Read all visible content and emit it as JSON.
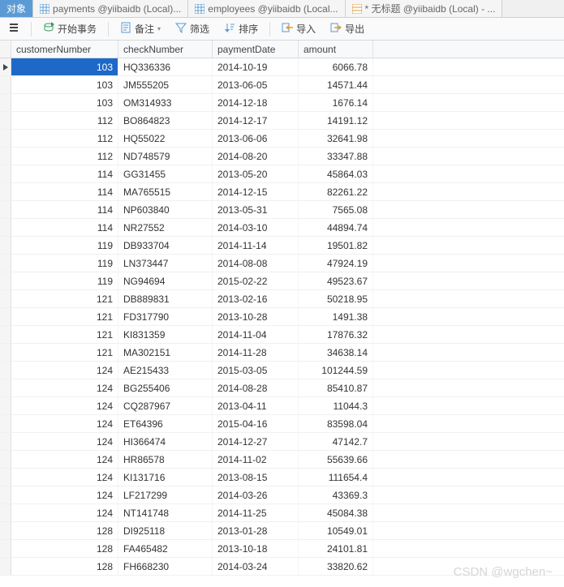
{
  "tabs": [
    {
      "label": "对象"
    },
    {
      "label": "payments @yiibaidb (Local)..."
    },
    {
      "label": "employees @yiibaidb (Local..."
    },
    {
      "label": "* 无标题 @yiibaidb (Local) - ..."
    }
  ],
  "toolbar": {
    "begin_tx": "开始事务",
    "memo": "备注",
    "filter": "筛选",
    "sort": "排序",
    "import": "导入",
    "export": "导出"
  },
  "columns": {
    "customerNumber": "customerNumber",
    "checkNumber": "checkNumber",
    "paymentDate": "paymentDate",
    "amount": "amount"
  },
  "rows": [
    {
      "customerNumber": "103",
      "checkNumber": "HQ336336",
      "paymentDate": "2014-10-19",
      "amount": "6066.78",
      "selected": true
    },
    {
      "customerNumber": "103",
      "checkNumber": "JM555205",
      "paymentDate": "2013-06-05",
      "amount": "14571.44"
    },
    {
      "customerNumber": "103",
      "checkNumber": "OM314933",
      "paymentDate": "2014-12-18",
      "amount": "1676.14"
    },
    {
      "customerNumber": "112",
      "checkNumber": "BO864823",
      "paymentDate": "2014-12-17",
      "amount": "14191.12"
    },
    {
      "customerNumber": "112",
      "checkNumber": "HQ55022",
      "paymentDate": "2013-06-06",
      "amount": "32641.98"
    },
    {
      "customerNumber": "112",
      "checkNumber": "ND748579",
      "paymentDate": "2014-08-20",
      "amount": "33347.88"
    },
    {
      "customerNumber": "114",
      "checkNumber": "GG31455",
      "paymentDate": "2013-05-20",
      "amount": "45864.03"
    },
    {
      "customerNumber": "114",
      "checkNumber": "MA765515",
      "paymentDate": "2014-12-15",
      "amount": "82261.22"
    },
    {
      "customerNumber": "114",
      "checkNumber": "NP603840",
      "paymentDate": "2013-05-31",
      "amount": "7565.08"
    },
    {
      "customerNumber": "114",
      "checkNumber": "NR27552",
      "paymentDate": "2014-03-10",
      "amount": "44894.74"
    },
    {
      "customerNumber": "119",
      "checkNumber": "DB933704",
      "paymentDate": "2014-11-14",
      "amount": "19501.82"
    },
    {
      "customerNumber": "119",
      "checkNumber": "LN373447",
      "paymentDate": "2014-08-08",
      "amount": "47924.19"
    },
    {
      "customerNumber": "119",
      "checkNumber": "NG94694",
      "paymentDate": "2015-02-22",
      "amount": "49523.67"
    },
    {
      "customerNumber": "121",
      "checkNumber": "DB889831",
      "paymentDate": "2013-02-16",
      "amount": "50218.95"
    },
    {
      "customerNumber": "121",
      "checkNumber": "FD317790",
      "paymentDate": "2013-10-28",
      "amount": "1491.38"
    },
    {
      "customerNumber": "121",
      "checkNumber": "KI831359",
      "paymentDate": "2014-11-04",
      "amount": "17876.32"
    },
    {
      "customerNumber": "121",
      "checkNumber": "MA302151",
      "paymentDate": "2014-11-28",
      "amount": "34638.14"
    },
    {
      "customerNumber": "124",
      "checkNumber": "AE215433",
      "paymentDate": "2015-03-05",
      "amount": "101244.59"
    },
    {
      "customerNumber": "124",
      "checkNumber": "BG255406",
      "paymentDate": "2014-08-28",
      "amount": "85410.87"
    },
    {
      "customerNumber": "124",
      "checkNumber": "CQ287967",
      "paymentDate": "2013-04-11",
      "amount": "11044.3"
    },
    {
      "customerNumber": "124",
      "checkNumber": "ET64396",
      "paymentDate": "2015-04-16",
      "amount": "83598.04"
    },
    {
      "customerNumber": "124",
      "checkNumber": "HI366474",
      "paymentDate": "2014-12-27",
      "amount": "47142.7"
    },
    {
      "customerNumber": "124",
      "checkNumber": "HR86578",
      "paymentDate": "2014-11-02",
      "amount": "55639.66"
    },
    {
      "customerNumber": "124",
      "checkNumber": "KI131716",
      "paymentDate": "2013-08-15",
      "amount": "111654.4"
    },
    {
      "customerNumber": "124",
      "checkNumber": "LF217299",
      "paymentDate": "2014-03-26",
      "amount": "43369.3"
    },
    {
      "customerNumber": "124",
      "checkNumber": "NT141748",
      "paymentDate": "2014-11-25",
      "amount": "45084.38"
    },
    {
      "customerNumber": "128",
      "checkNumber": "DI925118",
      "paymentDate": "2013-01-28",
      "amount": "10549.01"
    },
    {
      "customerNumber": "128",
      "checkNumber": "FA465482",
      "paymentDate": "2013-10-18",
      "amount": "24101.81"
    },
    {
      "customerNumber": "128",
      "checkNumber": "FH668230",
      "paymentDate": "2014-03-24",
      "amount": "33820.62"
    }
  ],
  "watermark": "CSDN @wgchen~"
}
